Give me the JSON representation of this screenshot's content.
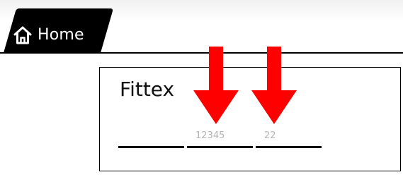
{
  "nav": {
    "home_label": "Home",
    "home_icon": "home-icon"
  },
  "form": {
    "title": "Fittex",
    "fields": [
      {
        "value": "",
        "placeholder": ""
      },
      {
        "value": "",
        "placeholder": "12345"
      },
      {
        "value": "",
        "placeholder": "22"
      }
    ]
  },
  "annotations": {
    "arrow_color": "#ff0000"
  }
}
